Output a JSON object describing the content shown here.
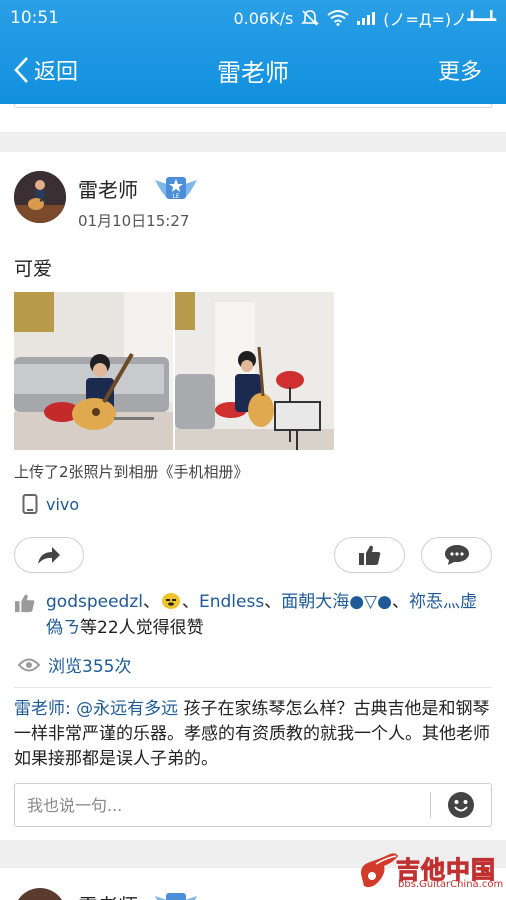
{
  "status_bar": {
    "time": "10:51",
    "speed": "0.06K/s",
    "emoticon": "(ノ=Д=)ノ┻━┻"
  },
  "nav": {
    "back_label": "返回",
    "title": "雷老师",
    "more_label": "更多"
  },
  "post": {
    "author": "雷老师",
    "badge_text": "LE",
    "date": "01月10日15:27",
    "text": "可爱",
    "photos": [
      "child-playing-guitar-photo-1",
      "child-playing-guitar-photo-2"
    ],
    "upload_note": "上传了2张照片到相册《手机相册》",
    "device": "vivo",
    "likes": {
      "names": [
        "godspeedzl",
        "、",
        "Endless",
        "、",
        "面朝大海●▽●",
        "、",
        "祢忢灬虚偽ㄋ"
      ],
      "suffix": "等22人觉得很赞"
    },
    "views": "浏览355次"
  },
  "comment": {
    "author": "雷老师:",
    "mention": "@永远有多远",
    "text": " 孩子在家练琴怎么样？古典吉他是和钢琴一样非常严谨的乐器。孝感的有资质教的就我一个人。其他老师如果接那都是误人子弟的。"
  },
  "comment_input": {
    "placeholder": "我也说一句..."
  },
  "next_post": {
    "author": "雷老师"
  },
  "watermark": {
    "text": "吉他中国",
    "url": "bbs.GuitarChina.com"
  },
  "colors": {
    "nav_bg": "#1a98e2",
    "link": "#1e5a96"
  },
  "icons": [
    "chevron-left-icon",
    "share-icon",
    "thumb-up-icon",
    "comment-icon",
    "eye-icon",
    "phone-icon",
    "emoji-icon",
    "wifi-icon",
    "mute-icon",
    "signal-icon"
  ]
}
